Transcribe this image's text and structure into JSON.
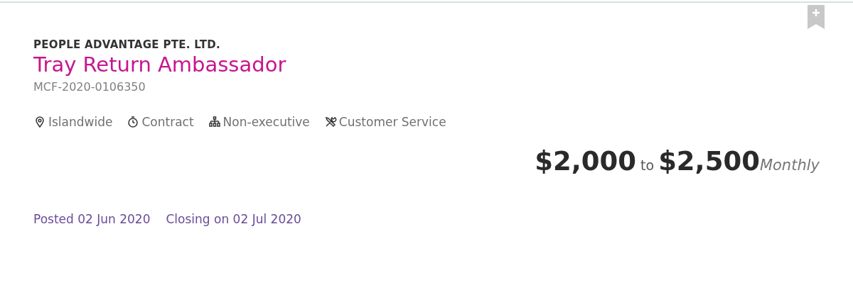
{
  "job": {
    "company": "PEOPLE ADVANTAGE PTE. LTD.",
    "title": "Tray Return Ambassador",
    "id": "MCF-2020-0106350",
    "tags": [
      {
        "kind": "location",
        "label": "Islandwide"
      },
      {
        "kind": "clock",
        "label": "Contract"
      },
      {
        "kind": "hierarchy",
        "label": "Non-executive"
      },
      {
        "kind": "tools",
        "label": "Customer Service"
      }
    ],
    "salary": {
      "min": "$2,000",
      "to": "to",
      "max": "$2,500",
      "period": "Monthly"
    },
    "posted": "Posted 02 Jun 2020",
    "closing": "Closing on 02 Jul 2020"
  }
}
